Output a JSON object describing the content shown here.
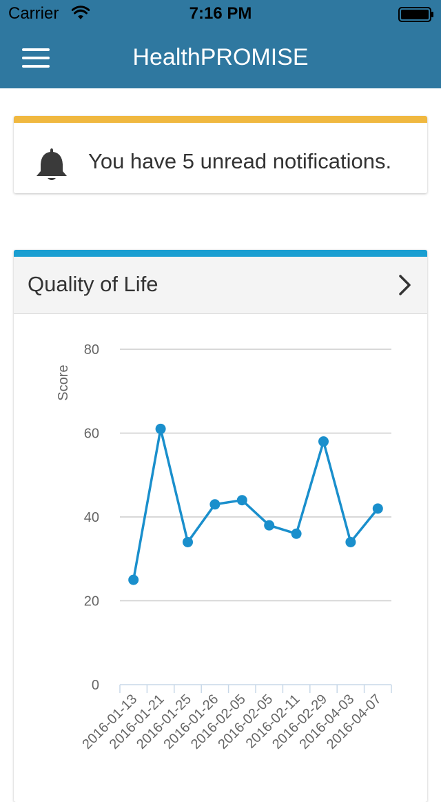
{
  "status_bar": {
    "carrier": "Carrier",
    "time": "7:16 PM",
    "wifi_icon": "wifi-icon",
    "battery_icon": "battery-icon"
  },
  "nav": {
    "title": "HealthPROMISE",
    "menu_icon": "hamburger-menu-icon"
  },
  "notification": {
    "text": "You have 5 unread notifications.",
    "icon": "bell-icon",
    "accent_color": "#f0b840"
  },
  "qol_card": {
    "title": "Quality of Life",
    "chevron_icon": "chevron-right-icon",
    "accent_color": "#1a9ed1"
  },
  "colors": {
    "navbar": "#2f78a0",
    "series": "#1a8fcc",
    "grid": "#cccccc"
  },
  "chart_data": {
    "type": "line",
    "ylabel": "Score",
    "xlabel": "",
    "ylim": [
      0,
      80
    ],
    "yticks": [
      0,
      20,
      40,
      60,
      80
    ],
    "grid": true,
    "categories": [
      "2016-01-13",
      "2016-01-21",
      "2016-01-25",
      "2016-01-26",
      "2016-02-05",
      "2016-02-05",
      "2016-02-11",
      "2016-02-29",
      "2016-04-03",
      "2016-04-07"
    ],
    "series": [
      {
        "values": [
          25,
          61,
          34,
          43,
          44,
          38,
          36,
          58,
          34,
          42
        ]
      }
    ]
  }
}
